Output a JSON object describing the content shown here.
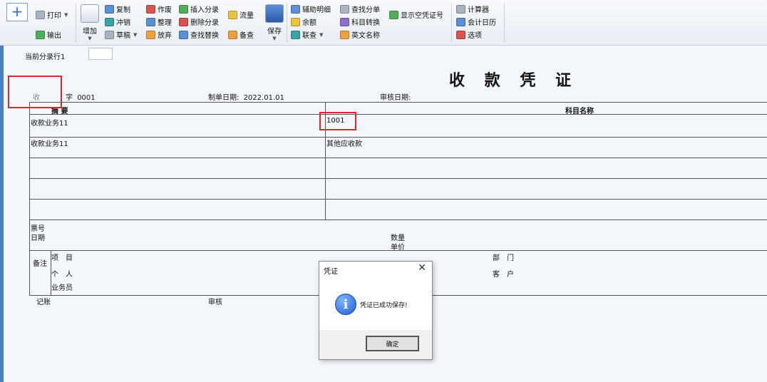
{
  "toolbar": {
    "new_tab": "+",
    "print": "打印",
    "export": "输出",
    "add": "增加",
    "copy": "复制",
    "reverse": "冲销",
    "draft": "草稿",
    "void": "作废",
    "tidy": "整理",
    "abandon": "放弃",
    "insert_entry": "插入分录",
    "delete_entry": "删除分录",
    "find_replace": "查找替换",
    "flow": "流量",
    "memo_check": "备查",
    "save": "保存",
    "aux_detail": "辅助明细",
    "balance": "余额",
    "link_query": "联查",
    "find_entry": "查找分单",
    "account_convert": "科目转换",
    "english_name": "英文名称",
    "show_empty_no": "显示空凭证号",
    "calculator": "计算器",
    "calendar": "会计日历",
    "options": "选项"
  },
  "form": {
    "current_row_label": "当前分录行1",
    "title": "收 款 凭 证",
    "voucher_type": "收",
    "number_label": "字",
    "number": "0001",
    "date_label": "制单日期:",
    "date": "2022.01.01",
    "audit_date_label": "审核日期:"
  },
  "table": {
    "col_summary": "摘 要",
    "col_account": "科目名称",
    "rows": [
      {
        "summary": "收款业务11",
        "account": "1001"
      },
      {
        "summary": "收款业务11",
        "account": "其他应收款"
      },
      {
        "summary": "",
        "account": ""
      },
      {
        "summary": "",
        "account": ""
      },
      {
        "summary": "",
        "account": ""
      }
    ],
    "ticket_no": "票号",
    "date": "日期",
    "quantity": "数量",
    "unit_price": "单价",
    "remark": "备注",
    "project": "项　目",
    "person": "个　人",
    "salesman": "业务员",
    "department": "部　门",
    "customer": "客　户"
  },
  "footer": {
    "bookkeeper": "记账",
    "auditor": "审核"
  },
  "dialog": {
    "title": "凭证",
    "close": "✕",
    "icon": "i",
    "message": "凭证已成功保存!",
    "ok": "确定"
  }
}
